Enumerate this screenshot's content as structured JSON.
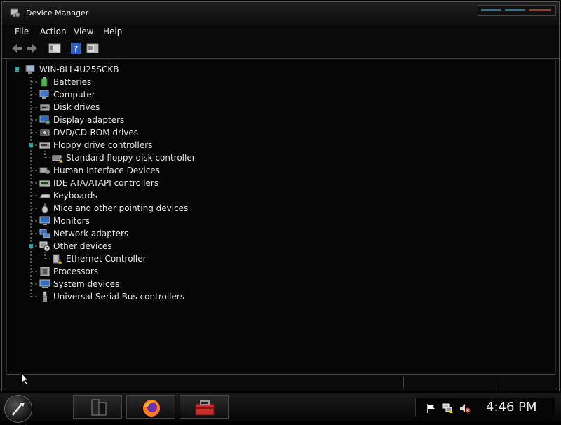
{
  "window": {
    "title": "Device Manager"
  },
  "menu": [
    "File",
    "Action",
    "View",
    "Help"
  ],
  "toolbar": {
    "buttons": [
      "back-icon",
      "forward-icon",
      "console-tree-icon",
      "help-icon",
      "properties-icon"
    ]
  },
  "tree": {
    "root": "WIN-8LL4U25SCKB",
    "items": [
      {
        "label": "Batteries",
        "icon": "battery-icon",
        "expanded": false
      },
      {
        "label": "Computer",
        "icon": "computer-icon",
        "expanded": false
      },
      {
        "label": "Disk drives",
        "icon": "disk-drive-icon",
        "expanded": false
      },
      {
        "label": "Display adapters",
        "icon": "display-adapter-icon",
        "expanded": false
      },
      {
        "label": "DVD/CD-ROM drives",
        "icon": "dvd-icon",
        "expanded": false
      },
      {
        "label": "Floppy drive controllers",
        "icon": "floppy-controller-icon",
        "expanded": true,
        "children": [
          {
            "label": "Standard floppy disk controller",
            "icon": "warning-device-icon"
          }
        ]
      },
      {
        "label": "Human Interface Devices",
        "icon": "hid-icon",
        "expanded": false
      },
      {
        "label": "IDE ATA/ATAPI controllers",
        "icon": "ide-icon",
        "expanded": false
      },
      {
        "label": "Keyboards",
        "icon": "keyboard-icon",
        "expanded": false
      },
      {
        "label": "Mice and other pointing devices",
        "icon": "mouse-icon",
        "expanded": false
      },
      {
        "label": "Monitors",
        "icon": "monitor-icon",
        "expanded": false
      },
      {
        "label": "Network adapters",
        "icon": "network-icon",
        "expanded": false
      },
      {
        "label": "Other devices",
        "icon": "other-devices-icon",
        "expanded": true,
        "children": [
          {
            "label": "Ethernet Controller",
            "icon": "warning-device-icon"
          }
        ]
      },
      {
        "label": "Processors",
        "icon": "processor-icon",
        "expanded": false
      },
      {
        "label": "System devices",
        "icon": "system-devices-icon",
        "expanded": false
      },
      {
        "label": "Universal Serial Bus controllers",
        "icon": "usb-icon",
        "expanded": false
      }
    ]
  },
  "taskbar": {
    "apps": [
      "server-manager-icon",
      "firefox-icon",
      "toolbox-icon"
    ],
    "tray_icons": [
      "flag-icon",
      "network-warning-icon",
      "volume-muted-icon"
    ],
    "clock": "4:46 PM"
  },
  "colors": {
    "accent": "#3c6e8a",
    "close": "#aa3333",
    "text": "#e6e6e6",
    "tree_line": "#8a8a8a"
  }
}
